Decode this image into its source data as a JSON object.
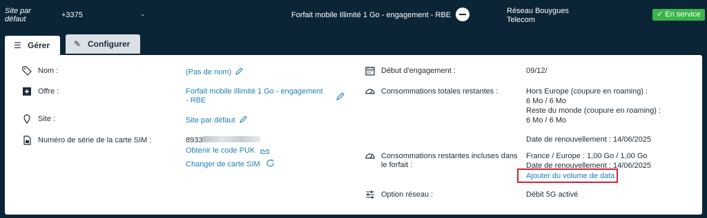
{
  "header": {
    "site_label": "Site par défaut",
    "phone": "+3375",
    "separator": "-",
    "plan": "Forfait mobile Illimité 1 Go - engagement - RBE",
    "network": "Réseau Bouygues Telecom",
    "status_badge": "✓ En service"
  },
  "tabs": [
    {
      "label": "Gérer",
      "icon": "sliders-icon",
      "active": true
    },
    {
      "label": "Configurer",
      "icon": "wrench-icon",
      "active": false
    }
  ],
  "left": {
    "name_label": "Nom :",
    "name_value": "(Pas de nom)",
    "offer_label": "Offre :",
    "offer_value": "Forfait mobile Illimité 1 Go - engagement - RBE",
    "site_label": "Site :",
    "site_value": "Site par défaut",
    "sim_label": "Numéro de série de la carte SIM :",
    "sim_value": "8933",
    "puk_link": "Obtenir le code PUK",
    "change_sim_link": "Changer de carte SIM"
  },
  "right": {
    "engagement_label": "Début d'engagement :",
    "engagement_value": "09/12/",
    "total_label": "Consommations totales restantes :",
    "total_line1": "Hors Europe (coupure en roaming) :",
    "total_line2": "6 Mo / 6 Mo",
    "total_line3": "Reste du monde (coupure en roaming) :",
    "total_line4": "6 Mo / 6 Mo",
    "total_renewal": "Date de renouvellement : 14/06/2025",
    "included_label": "Consommations restantes incluses dans le forfait :",
    "included_line1": "France / Europe : 1,00 Go / 1,00 Go",
    "included_renewal": "Date de renouvellement : 14/06/2025",
    "add_data_link": "Ajouter du volume de data",
    "network_option_label": "Option réseau :",
    "network_option_value": "Débit 5G activé"
  },
  "colors": {
    "header_bg": "#0c2536",
    "link": "#1e7fb4",
    "badge": "#3bb54a",
    "highlight": "#d81e35"
  }
}
